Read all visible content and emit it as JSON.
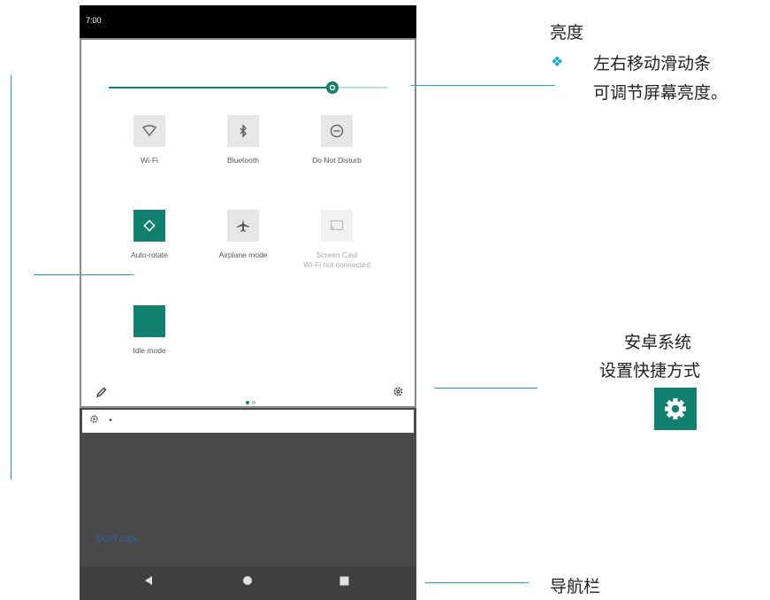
{
  "status_bar": {
    "time": "7:00"
  },
  "brightness": {
    "level": 0.8
  },
  "tiles": [
    {
      "label": "Wi-Fi",
      "sublabel": "",
      "icon": "wifi-icon",
      "state": "off"
    },
    {
      "label": "Bluetooth",
      "sublabel": "",
      "icon": "bluetooth-icon",
      "state": "off"
    },
    {
      "label": "Do Not Disturb",
      "sublabel": "",
      "icon": "do-not-disturb-icon",
      "state": "off"
    },
    {
      "label": "Auto-rotate",
      "sublabel": "",
      "icon": "auto-rotate-icon",
      "state": "on"
    },
    {
      "label": "Airplane mode",
      "sublabel": "",
      "icon": "airplane-icon",
      "state": "off"
    },
    {
      "label": "Screen Cast",
      "sublabel": "Wi-Fi not connected",
      "icon": "cast-icon",
      "state": "disabled"
    },
    {
      "label": "Idle mode",
      "sublabel": "",
      "icon": "moon-icon",
      "state": "on"
    }
  ],
  "watermark": "Don't copy",
  "annotations": {
    "brightness_title": "亮度",
    "brightness_line1": "左右移动滑动条",
    "brightness_line2": "可调节屏幕亮度。",
    "settings_line1": "安卓系统",
    "settings_line2": "设置快捷方式",
    "navbar_label": "导航栏"
  },
  "colors": {
    "accent": "#11806e",
    "callout_line": "#1aa3d9"
  }
}
